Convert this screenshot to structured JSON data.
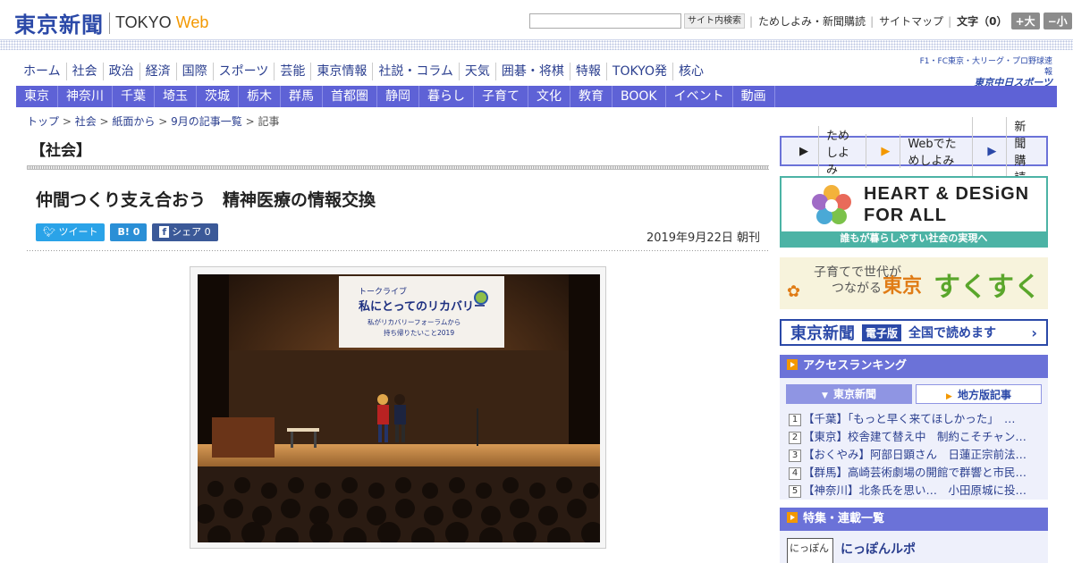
{
  "header": {
    "logo_jp": "東京新聞",
    "logo_en_main": "TOKYO",
    "logo_en_web": "Web",
    "search_button": "サイト内検索",
    "link_trial": "ためしよみ・新聞購読",
    "link_sitemap": "サイトマップ",
    "font_label": "文字（0）",
    "font_bigger": "+大",
    "font_smaller": "−小"
  },
  "main_nav": [
    "ホーム",
    "社会",
    "政治",
    "経済",
    "国際",
    "スポーツ",
    "芸能",
    "東京情報",
    "社説・コラム",
    "天気",
    "囲碁・将棋",
    "特報",
    "TOKYO発",
    "核心"
  ],
  "promo_small": {
    "line1": "F1・FC東京・大リーグ・プロ野球速報",
    "line2": "東京中日スポーツ"
  },
  "region_nav": [
    "東京",
    "神奈川",
    "千葉",
    "埼玉",
    "茨城",
    "栃木",
    "群馬",
    "首都圏",
    "静岡",
    "暮らし",
    "子育て",
    "文化",
    "教育",
    "BOOK",
    "イベント",
    "動画"
  ],
  "breadcrumb": {
    "items": [
      "トップ",
      "社会",
      "紙面から",
      "9月の記事一覧"
    ],
    "current": "記事",
    "sep": " > "
  },
  "article": {
    "section": "【社会】",
    "headline": "仲間つくり支え合おう　精神医療の情報交換",
    "share_tweet": "ツイート",
    "share_hatena": "B! 0",
    "share_facebook": "シェア 0",
    "date": "2019年9月22日 朝刊",
    "photo_screen_line1": "トークライブ",
    "photo_screen_line2": "私にとってのリカバリー",
    "photo_screen_line3": "私がリカバリーフォーラムから",
    "photo_screen_line4": "持ち帰りたいこと2019"
  },
  "sidebar": {
    "subscribe": [
      "ためしよみ",
      "Webでためしよみ",
      "新聞購読"
    ],
    "hd_title_1": "HEART & DESiGN",
    "hd_title_2": "FOR ALL",
    "hd_sub": "誰もが暮らしやすい社会の実現へ",
    "kosodate_1": "子育てで世代が",
    "kosodate_2": "つながる",
    "kosodate_3": "東京",
    "kosodate_4": "すくすく",
    "denshi_1": "東京新聞",
    "denshi_2": "電子版",
    "denshi_3": "全国で読めます",
    "ranking_title": "アクセスランキング",
    "ranking_tab_1": "東京新聞",
    "ranking_tab_2": "地方版記事",
    "ranking": [
      {
        "num": "1",
        "text": "【千葉】「もっと早く来てほしかった」　…"
      },
      {
        "num": "2",
        "text": "【東京】校舎建て替え中　制約こそチャン…"
      },
      {
        "num": "3",
        "text": "【おくやみ】阿部日顕さん　日蓮正宗前法…"
      },
      {
        "num": "4",
        "text": "【群馬】高崎芸術劇場の開館で群響と市民…"
      },
      {
        "num": "5",
        "text": "【神奈川】北条氏を思い…　小田原城に投…"
      }
    ],
    "features_title": "特集・連載一覧",
    "feature_thumb": "にっぽん",
    "feature_title": "にっぽんルポ"
  },
  "colors": {
    "brand_blue": "#2b49a8",
    "nav_purple": "#5e62d6",
    "accent_orange": "#f39800",
    "teal": "#4cb3a5"
  }
}
